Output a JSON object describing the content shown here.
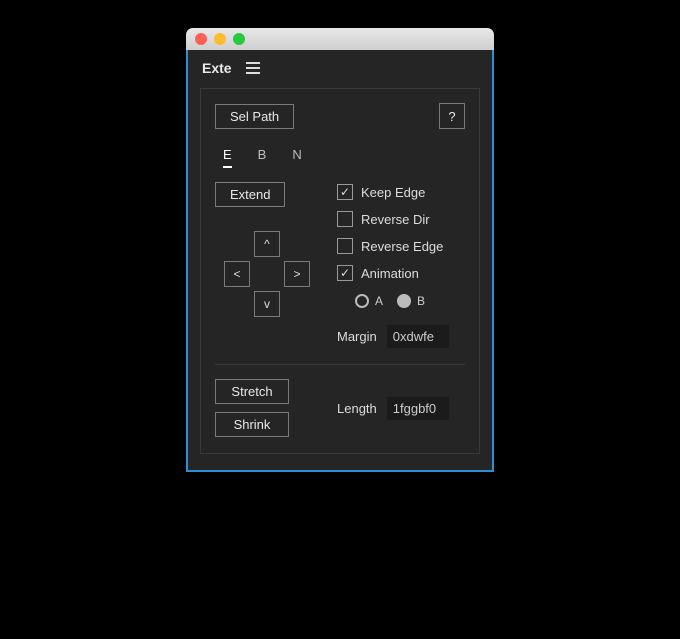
{
  "panel": {
    "title": "Exte"
  },
  "top": {
    "selPath": "Sel Path",
    "help": "?"
  },
  "tabs": {
    "items": [
      "E",
      "B",
      "N"
    ],
    "activeIndex": 0
  },
  "left": {
    "extend": "Extend",
    "dpad": {
      "up": "^",
      "down": "v",
      "left": "<",
      "right": ">"
    }
  },
  "options": {
    "keepEdge": {
      "label": "Keep Edge",
      "checked": true
    },
    "reverseDir": {
      "label": "Reverse Dir",
      "checked": false
    },
    "reverseEdge": {
      "label": "Reverse Edge",
      "checked": false
    },
    "animation": {
      "label": "Animation",
      "checked": true
    },
    "radios": {
      "a": "A",
      "b": "B",
      "selected": "B"
    },
    "margin": {
      "label": "Margin",
      "value": "0xdwfe"
    }
  },
  "bottom": {
    "stretch": "Stretch",
    "shrink": "Shrink",
    "length": {
      "label": "Length",
      "value": "1fggbf0"
    }
  }
}
